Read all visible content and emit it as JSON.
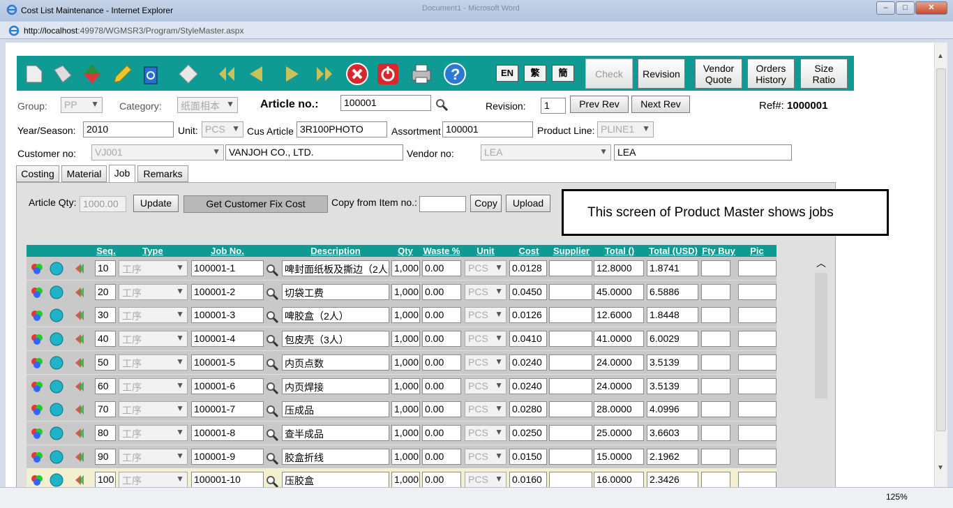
{
  "window": {
    "title": "Cost List Maintenance - Internet Explorer",
    "ghost_title": "Document1 - Microsoft Word",
    "minimize": "–",
    "maximize": "□",
    "close": "✕"
  },
  "address": {
    "url_host": "http://localhost",
    "url_rest": ":49978/WGMSR3/Program/StyleMaster.aspx"
  },
  "toolbar": {
    "lang_en": "EN",
    "lang_tc": "繁",
    "lang_sc": "簡",
    "check": "Check",
    "revision": "Revision",
    "vendor_quote": "Vendor\nQuote",
    "orders_history": "Orders\nHistory",
    "size_ratio": "Size\nRatio"
  },
  "header": {
    "group_label": "Group:",
    "group_value": "PP",
    "category_label": "Category:",
    "category_value": "纸面相本",
    "article_label": "Article no.:",
    "article_value": "100001",
    "revision_label": "Revision:",
    "revision_value": "1",
    "prev_rev": "Prev Rev",
    "next_rev": "Next Rev",
    "ref_label": "Ref#:",
    "ref_value": "1000001",
    "year_label": "Year/Season:",
    "year_value": "2010",
    "unit_label": "Unit:",
    "unit_value": "PCS",
    "cus_article_label": "Cus Article",
    "cus_article_value": "3R100PHOTO",
    "assortment_label": "Assortment",
    "assortment_value": "100001",
    "product_line_label": "Product Line:",
    "product_line_value": "PLINE1",
    "customer_label": "Customer no:",
    "customer_value": "VJ001",
    "customer_name": "VANJOH CO., LTD.",
    "vendor_label": "Vendor no:",
    "vendor_value": "LEA",
    "vendor_name": "LEA"
  },
  "tabs": [
    "Costing",
    "Material",
    "Job",
    "Remarks"
  ],
  "job": {
    "article_qty_label": "Article Qty:",
    "article_qty_value": "1000.00",
    "update": "Update",
    "get_fix_cost": "Get Customer Fix Cost",
    "copy_from_label": "Copy from Item no.:",
    "copy": "Copy",
    "upload": "Upload"
  },
  "callout": "This screen of Product Master shows jobs",
  "grid": {
    "headers": [
      "Seq.",
      "Type",
      "Job No.",
      "Description",
      "Qty",
      "Waste %",
      "Unit",
      "Cost",
      "Supplier",
      "Total ()",
      "Total (USD)",
      "Fty Buy",
      "Pic"
    ],
    "rows": [
      {
        "seq": "10",
        "type": "工序",
        "job": "100001-1",
        "desc": "啤封面纸板及撕边（2人",
        "qty": "1,000",
        "waste": "0.00",
        "unit": "PCS",
        "cost": "0.0128",
        "total": "12.8000",
        "usd": "1.8741"
      },
      {
        "seq": "20",
        "type": "工序",
        "job": "100001-2",
        "desc": "切袋工费",
        "qty": "1,000",
        "waste": "0.00",
        "unit": "PCS",
        "cost": "0.0450",
        "total": "45.0000",
        "usd": "6.5886"
      },
      {
        "seq": "30",
        "type": "工序",
        "job": "100001-3",
        "desc": "啤胶盒（2人）",
        "qty": "1,000",
        "waste": "0.00",
        "unit": "PCS",
        "cost": "0.0126",
        "total": "12.6000",
        "usd": "1.8448"
      },
      {
        "seq": "40",
        "type": "工序",
        "job": "100001-4",
        "desc": "包皮壳（3人）",
        "qty": "1,000",
        "waste": "0.00",
        "unit": "PCS",
        "cost": "0.0410",
        "total": "41.0000",
        "usd": "6.0029"
      },
      {
        "seq": "50",
        "type": "工序",
        "job": "100001-5",
        "desc": "内页点数",
        "qty": "1,000",
        "waste": "0.00",
        "unit": "PCS",
        "cost": "0.0240",
        "total": "24.0000",
        "usd": "3.5139"
      },
      {
        "seq": "60",
        "type": "工序",
        "job": "100001-6",
        "desc": "内页焊接",
        "qty": "1,000",
        "waste": "0.00",
        "unit": "PCS",
        "cost": "0.0240",
        "total": "24.0000",
        "usd": "3.5139"
      },
      {
        "seq": "70",
        "type": "工序",
        "job": "100001-7",
        "desc": "压成品",
        "qty": "1,000",
        "waste": "0.00",
        "unit": "PCS",
        "cost": "0.0280",
        "total": "28.0000",
        "usd": "4.0996"
      },
      {
        "seq": "80",
        "type": "工序",
        "job": "100001-8",
        "desc": "查半成品",
        "qty": "1,000",
        "waste": "0.00",
        "unit": "PCS",
        "cost": "0.0250",
        "total": "25.0000",
        "usd": "3.6603"
      },
      {
        "seq": "90",
        "type": "工序",
        "job": "100001-9",
        "desc": "胶盒折线",
        "qty": "1,000",
        "waste": "0.00",
        "unit": "PCS",
        "cost": "0.0150",
        "total": "15.0000",
        "usd": "2.1962"
      },
      {
        "seq": "100",
        "type": "工序",
        "job": "100001-10",
        "desc": "压胶盒",
        "qty": "1,000",
        "waste": "0.00",
        "unit": "PCS",
        "cost": "0.0160",
        "total": "16.0000",
        "usd": "2.3426"
      }
    ]
  },
  "status": {
    "zoom": "125%"
  }
}
